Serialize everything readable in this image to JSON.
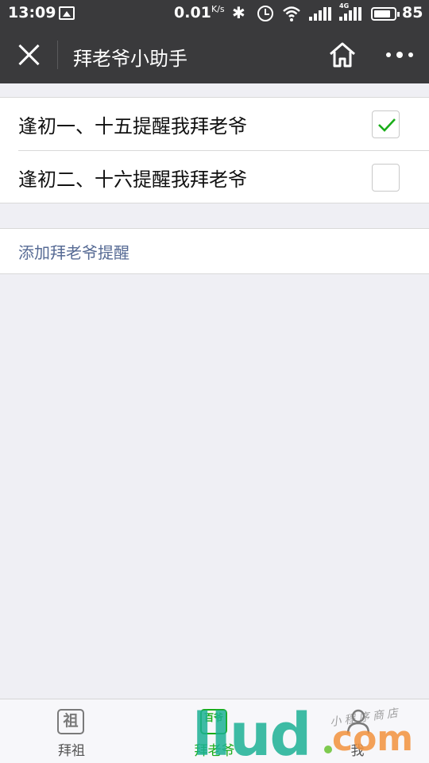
{
  "status_bar": {
    "time": "13:09",
    "network_speed": "0.01",
    "speed_unit": "K/s",
    "network_type": "4G",
    "battery_level": "85"
  },
  "nav": {
    "title": "拜老爷小助手"
  },
  "reminders": [
    {
      "label": "逢初一、十五提醒我拜老爷",
      "checked": true
    },
    {
      "label": "逢初二、十六提醒我拜老爷",
      "checked": false
    }
  ],
  "add_link": "添加拜老爷提醒",
  "tabs": [
    {
      "label": "拜祖",
      "icon_text": "祖",
      "icon": "ancestor-tablet-icon",
      "active": false
    },
    {
      "label": "拜老爷",
      "icon_text": "百爷",
      "icon": "deity-tablet-icon",
      "active": true
    },
    {
      "label": "我",
      "icon": "person-icon",
      "active": false
    }
  ],
  "watermark": {
    "brand": "llud",
    "suffix": "com",
    "script_text": "小程序商店"
  },
  "colors": {
    "nav_background": "#3a3a3c",
    "accent_green": "#1aad19",
    "link_blue": "#576b95",
    "page_background": "#efeff4"
  }
}
